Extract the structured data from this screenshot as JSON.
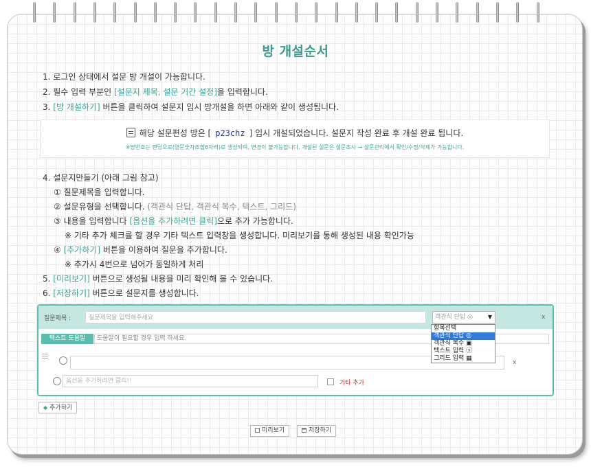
{
  "title": "방 개설순서",
  "steps_top": {
    "s1": "1. 로그인 상태에서 설문 방 개설이 가능합니다.",
    "s2_pre": "2. 필수 입력 부분인 ",
    "s2_hl": "[설문지 제목, 설문 기간 설정]",
    "s2_post": "을 입력합니다.",
    "s3_pre": "3. ",
    "s3_hl": "[방 개설하기]",
    "s3_post": " 버튼을 클릭하여 설문지 임시 방개설을 하면 아래와 같이 생성됩니다."
  },
  "info": {
    "pre": "해당 설문편성 방은 [",
    "code": "p23chz",
    "post": "] 임시 개설되었습니다.  설문지 작성 완료 후 개설 완료 됩니다.",
    "note": "※방번호는 랜덤으로(영문숫자조합6자리)로 생성되며, 변경이 불가능합니다. 개설된 설문은 설문조사 → 설문관리에서 확인/수정/삭제가 가능합니다."
  },
  "steps_bottom": {
    "s4": "4. 설문지만들기 (아래 그림 참고)",
    "s4_1": "① 질문제목을 입력합니다.",
    "s4_2_pre": "② 설문유형을 선택합니다. ",
    "s4_2_gray": "(객관식 단답, 객관식 복수, 텍스트, 그리드)",
    "s4_3_pre": "③ 내용을 입력합니다 ",
    "s4_3_hl": "[옵션을 추가하려면 클릭]",
    "s4_3_post": "으로 추가 가능합니다.",
    "s4_3_note": "※ 기타 추가 체크를 할 경우 기타 텍스트 입력창을 생성합니다. 미리보기를 통해 생성된 내용 확인가능",
    "s4_4_pre": "④ ",
    "s4_4_hl": "[추가하기]",
    "s4_4_post": " 버튼을 이용하여 질문을 추가합니다.",
    "s4_4_note": "※ 추가시 4번으로 넘어가 동일하게 처리",
    "s5_pre": "5. ",
    "s5_hl": "[미리보기]",
    "s5_post": " 버튼으로 생성될 내용을 미리 확인해 볼 수 있습니다.",
    "s6_pre": "6. ",
    "s6_hl": "[저장하기]",
    "s6_post": " 버튼으로 설문지를 생성합니다."
  },
  "question": {
    "label": "질문제목 :",
    "title_placeholder": "질문제목을 입력해주세요",
    "type_selected": "객관식 단답 ◎",
    "close": "x",
    "help_badge": "텍스트 도움말",
    "help_placeholder": "도움말이 필요할 경우 입력 하세요.",
    "option_close": "x",
    "add_option_placeholder": "옵션을 추가하려면 클릭!!",
    "etc_label": "기타 추가"
  },
  "dropdown_options": [
    "항목선택",
    "객관식 단답 ◎",
    "객관식 복수 ▣",
    "텍스트 입력 ⓢ",
    "그리드 입력 ▦"
  ],
  "buttons": {
    "add": "추가하기",
    "preview": "미리보기",
    "save": "저장하기"
  },
  "colors": {
    "accent": "#3aa394",
    "panel_border": "#5cbcae",
    "panel_header": "#c5e7e1",
    "code": "#2233bb",
    "etc_red": "#e03030",
    "dropdown_highlight": "#3478d8"
  }
}
